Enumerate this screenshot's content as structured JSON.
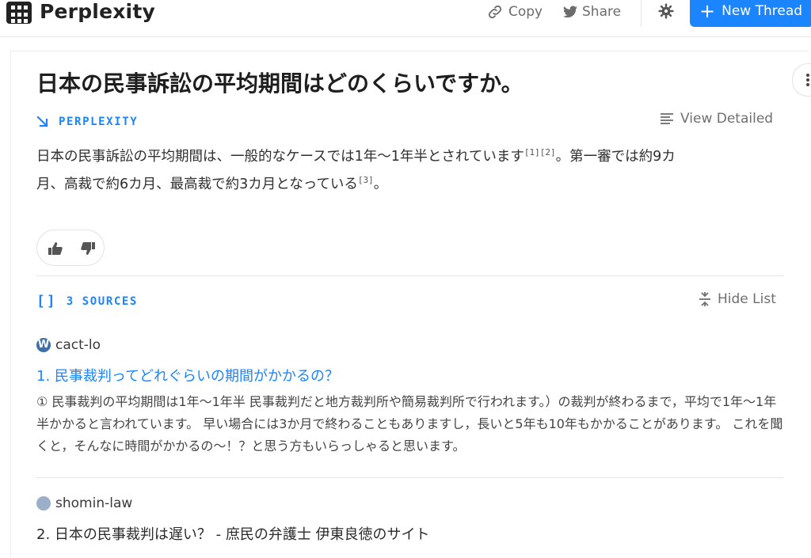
{
  "header": {
    "brand": "Perplexity",
    "copy_label": "Copy",
    "share_label": "Share",
    "new_thread_label": "New Thread"
  },
  "question": "日本の民事訴訟の平均期間はどのくらいですか。",
  "answer_section": {
    "label": "PERPLEXITY",
    "view_detailed_label": "View Detailed",
    "text_line1_a": "日本の民事訴訟の平均期間は、一般的なケースでは1年〜1年半とされています",
    "cite1": "[1]",
    "cite2": "[2]",
    "text_line1_b": "。第一審では約9カ",
    "text_line2_a": "月、高裁で約6カ月、最高裁で約3カ月となっている",
    "cite3": "[3]",
    "text_line2_b": "。"
  },
  "sources_section": {
    "label": "3 SOURCES",
    "hide_list_label": "Hide List",
    "sources": [
      {
        "site": "cact-lo",
        "title": "1. 民事裁判ってどれぐらいの期間がかかるの？",
        "snippet": "① 民事裁判の平均期間は1年〜1年半 民事裁判だと地方裁判所や簡易裁判所で行われます。）の裁判が終わるまで，平均で1年〜1年半かかると言われています。 早い場合には3か月で終わることもありますし，長いと5年も10年もかかることがあります。 これを聞くと，そんなに時間がかかるの〜！？と思う方もいらっしゃると思います。"
      },
      {
        "site": "shomin-law",
        "title": "2. 日本の民事裁判は遅い？ - 庶民の弁護士 伊東良徳のサイト"
      }
    ]
  },
  "colors": {
    "accent": "#1b84ff",
    "text": "#2b2b2b",
    "muted": "#6f6f6f"
  }
}
